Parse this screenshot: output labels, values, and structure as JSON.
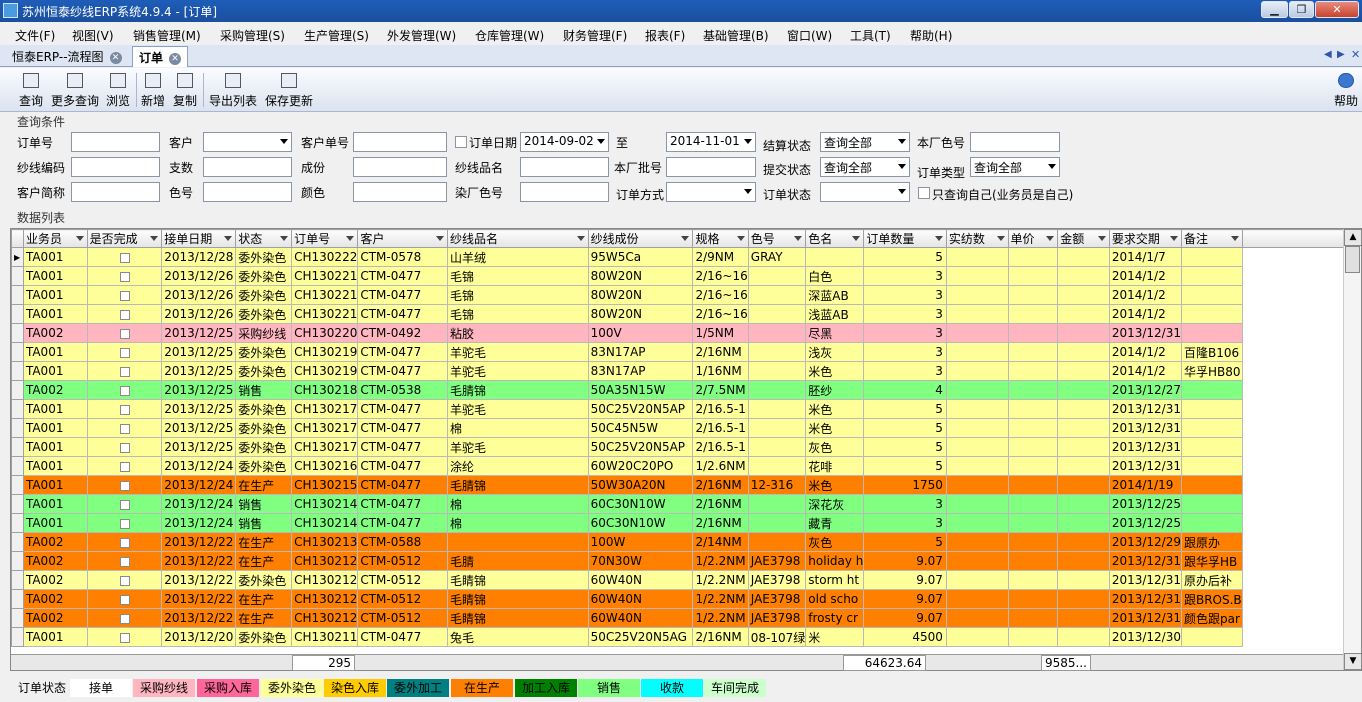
{
  "window": {
    "title": "苏州恒泰纱线ERP系统4.9.4 - [订单]"
  },
  "menu": [
    "文件(F)",
    "视图(V)",
    "销售管理(M)",
    "采购管理(S)",
    "生产管理(S)",
    "外发管理(W)",
    "仓库管理(W)",
    "财务管理(F)",
    "报表(F)",
    "基础管理(B)",
    "窗口(W)",
    "工具(T)",
    "帮助(H)"
  ],
  "tabs": [
    {
      "label": "恒泰ERP--流程图"
    },
    {
      "label": "订单"
    }
  ],
  "toolbar": {
    "buttons": [
      "查询",
      "更多查询",
      "浏览",
      "新增",
      "复制",
      "导出列表",
      "保存更新"
    ],
    "help": "帮助"
  },
  "query": {
    "section_label": "查询条件",
    "labels": {
      "order_no": "订单号",
      "customer": "客户",
      "cust_order_no": "客户单号",
      "order_date": "订单日期",
      "to": "至",
      "settle_status": "结算状态",
      "factory_color": "本厂色号",
      "yarn_code": "纱线编码",
      "count": "支数",
      "composition": "成份",
      "yarn_name": "纱线品名",
      "factory_batch": "本厂批号",
      "submit_status": "提交状态",
      "order_type": "订单类型",
      "cust_abbr": "客户简称",
      "color_no": "色号",
      "color": "颜色",
      "dye_color_no": "染厂色号",
      "order_method": "订单方式",
      "order_status": "订单状态",
      "only_mine": "只查询自己(业务员是自己)"
    },
    "values": {
      "date_from": "2014-09-02",
      "date_to": "2014-11-01",
      "settle_status": "查询全部",
      "submit_status": "查询全部",
      "order_type": "查询全部"
    }
  },
  "grid": {
    "section_label": "数据列表",
    "columns": [
      "业务员",
      "是否完成",
      "接单日期",
      "状态",
      "订单号",
      "客户",
      "纱线品名",
      "纱线成份",
      "规格",
      "色号",
      "色名",
      "订单数量",
      "实纺数",
      "单价",
      "金额",
      "要求交期",
      "备注"
    ],
    "rows": [
      {
        "c": [
          "TA001",
          "",
          "2013/12/28",
          "委外染色",
          "CH130222",
          "CTM-0578",
          "山羊绒",
          "95W5Ca",
          "2/9NM",
          "GRAY",
          "",
          "5",
          "",
          "",
          "",
          "2014/1/7",
          ""
        ],
        "bg": "#ffff99"
      },
      {
        "c": [
          "TA001",
          "",
          "2013/12/26",
          "委外染色",
          "CH130221",
          "CTM-0477",
          "毛锦",
          "80W20N",
          "2/16~16",
          "",
          "白色",
          "3",
          "",
          "",
          "",
          "2014/1/2",
          ""
        ],
        "bg": "#ffff99"
      },
      {
        "c": [
          "TA001",
          "",
          "2013/12/26",
          "委外染色",
          "CH130221",
          "CTM-0477",
          "毛锦",
          "80W20N",
          "2/16~16",
          "",
          "深蓝AB",
          "3",
          "",
          "",
          "",
          "2014/1/2",
          ""
        ],
        "bg": "#ffff99"
      },
      {
        "c": [
          "TA001",
          "",
          "2013/12/26",
          "委外染色",
          "CH130221",
          "CTM-0477",
          "毛锦",
          "80W20N",
          "2/16~16",
          "",
          "浅蓝AB",
          "3",
          "",
          "",
          "",
          "2014/1/2",
          ""
        ],
        "bg": "#ffff99"
      },
      {
        "c": [
          "TA002",
          "",
          "2013/12/25",
          "采购纱线",
          "CH130220",
          "CTM-0492",
          "粘胶",
          "100V",
          "1/5NM",
          "",
          "尽黑",
          "3",
          "",
          "",
          "",
          "2013/12/31",
          ""
        ],
        "bg": "#ffb6c1"
      },
      {
        "c": [
          "TA001",
          "",
          "2013/12/25",
          "委外染色",
          "CH130219",
          "CTM-0477",
          "羊驼毛",
          "83N17AP",
          "2/16NM",
          "",
          "浅灰",
          "3",
          "",
          "",
          "",
          "2014/1/2",
          "百隆B106"
        ],
        "bg": "#ffff99"
      },
      {
        "c": [
          "TA001",
          "",
          "2013/12/25",
          "委外染色",
          "CH130219",
          "CTM-0477",
          "羊驼毛",
          "83N17AP",
          "1/16NM",
          "",
          "米色",
          "3",
          "",
          "",
          "",
          "2014/1/2",
          "华孚HB80"
        ],
        "bg": "#ffff99"
      },
      {
        "c": [
          "TA002",
          "",
          "2013/12/25",
          "销售",
          "CH130218",
          "CTM-0538",
          "毛腈锦",
          "50A35N15W",
          "2/7.5NM",
          "",
          "胚纱",
          "4",
          "",
          "",
          "",
          "2013/12/27",
          ""
        ],
        "bg": "#80ff80"
      },
      {
        "c": [
          "TA001",
          "",
          "2013/12/25",
          "委外染色",
          "CH130217",
          "CTM-0477",
          "羊驼毛",
          "50C25V20N5AP",
          "2/16.5-1",
          "",
          "米色",
          "5",
          "",
          "",
          "",
          "2013/12/31",
          ""
        ],
        "bg": "#ffff99"
      },
      {
        "c": [
          "TA001",
          "",
          "2013/12/25",
          "委外染色",
          "CH130217",
          "CTM-0477",
          "棉",
          "50C45N5W",
          "2/16.5-1",
          "",
          "米色",
          "5",
          "",
          "",
          "",
          "2013/12/31",
          ""
        ],
        "bg": "#ffff99"
      },
      {
        "c": [
          "TA001",
          "",
          "2013/12/25",
          "委外染色",
          "CH130217",
          "CTM-0477",
          "羊驼毛",
          "50C25V20N5AP",
          "2/16.5-1",
          "",
          "灰色",
          "5",
          "",
          "",
          "",
          "2013/12/31",
          ""
        ],
        "bg": "#ffff99"
      },
      {
        "c": [
          "TA001",
          "",
          "2013/12/24",
          "委外染色",
          "CH130216",
          "CTM-0477",
          "涂纶",
          "60W20C20PO",
          "1/2.6NM",
          "",
          "花啡",
          "5",
          "",
          "",
          "",
          "2013/12/31",
          ""
        ],
        "bg": "#ffff99"
      },
      {
        "c": [
          "TA001",
          "",
          "2013/12/24",
          "在生产",
          "CH130215",
          "CTM-0477",
          "毛腈锦",
          "50W30A20N",
          "2/16NM",
          "12-316",
          "米色",
          "1750",
          "",
          "",
          "",
          "2014/1/19",
          ""
        ],
        "bg": "#ff8000"
      },
      {
        "c": [
          "TA001",
          "",
          "2013/12/24",
          "销售",
          "CH130214",
          "CTM-0477",
          "棉",
          "60C30N10W",
          "2/16NM",
          "",
          "深花灰",
          "3",
          "",
          "",
          "",
          "2013/12/25",
          ""
        ],
        "bg": "#80ff80"
      },
      {
        "c": [
          "TA001",
          "",
          "2013/12/24",
          "销售",
          "CH130214",
          "CTM-0477",
          "棉",
          "60C30N10W",
          "2/16NM",
          "",
          "藏青",
          "3",
          "",
          "",
          "",
          "2013/12/25",
          ""
        ],
        "bg": "#80ff80"
      },
      {
        "c": [
          "TA002",
          "",
          "2013/12/22",
          "在生产",
          "CH130213",
          "CTM-0588",
          "",
          "100W",
          "2/14NM",
          "",
          "灰色",
          "5",
          "",
          "",
          "",
          "2013/12/29",
          "跟原办"
        ],
        "bg": "#ff8000"
      },
      {
        "c": [
          "TA002",
          "",
          "2013/12/22",
          "在生产",
          "CH130212",
          "CTM-0512",
          "毛腈",
          "70N30W",
          "1/2.2NM",
          "JAE3798",
          "holiday h",
          "9.07",
          "",
          "",
          "",
          "2013/12/31",
          "跟华孚HB"
        ],
        "bg": "#ff8000"
      },
      {
        "c": [
          "TA002",
          "",
          "2013/12/22",
          "委外染色",
          "CH130212",
          "CTM-0512",
          "毛睛锦",
          "60W40N",
          "1/2.2NM",
          "JAE3798",
          "storm ht",
          "9.07",
          "",
          "",
          "",
          "2013/12/31",
          "原办后补"
        ],
        "bg": "#ffff99"
      },
      {
        "c": [
          "TA002",
          "",
          "2013/12/22",
          "在生产",
          "CH130212",
          "CTM-0512",
          "毛睛锦",
          "60W40N",
          "1/2.2NM",
          "JAE3798",
          "old scho",
          "9.07",
          "",
          "",
          "",
          "2013/12/31",
          "跟BROS.B"
        ],
        "bg": "#ff8000"
      },
      {
        "c": [
          "TA002",
          "",
          "2013/12/22",
          "在生产",
          "CH130212",
          "CTM-0512",
          "毛睛锦",
          "60W40N",
          "1/2.2NM",
          "JAE3798",
          "frosty cr",
          "9.07",
          "",
          "",
          "",
          "2013/12/31",
          "颜色跟par"
        ],
        "bg": "#ff8000"
      },
      {
        "c": [
          "TA001",
          "",
          "2013/12/20",
          "委外染色",
          "CH130211",
          "CTM-0477",
          "兔毛",
          "50C25V20N5AG",
          "2/16NM",
          "08-107绿",
          "米",
          "4500",
          "",
          "",
          "",
          "2013/12/30",
          ""
        ],
        "bg": "#ffff99"
      }
    ],
    "totals": {
      "order_no_count": "295",
      "order_qty": "64623.64",
      "amount": "9585..."
    }
  },
  "legend": {
    "label": "订单状态",
    "items": [
      {
        "name": "接单",
        "color": "#ffffff"
      },
      {
        "name": "采购纱线",
        "color": "#ffb6c1"
      },
      {
        "name": "采购入库",
        "color": "#ff6699"
      },
      {
        "name": "委外染色",
        "color": "#ffff99"
      },
      {
        "name": "染色入库",
        "color": "#ffcc00"
      },
      {
        "name": "委外加工",
        "color": "#008080"
      },
      {
        "name": "在生产",
        "color": "#ff8000"
      },
      {
        "name": "加工入库",
        "color": "#008000"
      },
      {
        "name": "销售",
        "color": "#80ff80"
      },
      {
        "name": "收款",
        "color": "#00ffff"
      },
      {
        "name": "车间完成",
        "color": "#ccffcc"
      }
    ]
  }
}
